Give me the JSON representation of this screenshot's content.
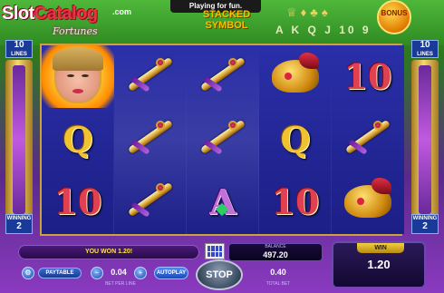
{
  "header": {
    "playing_banner": "Playing for fun.",
    "logo_slot": "Slot",
    "logo_catalog": "Catalog",
    "logo_com": ".com",
    "logo_sub": "Fortunes",
    "stacked_line1": "STACKED",
    "stacked_line2": "SYMBOL",
    "mini_letters": "A K Q J 10 9",
    "bonus_label": "BONUS"
  },
  "sides": {
    "left_lines_value": "10",
    "left_lines_label": "LINES",
    "right_lines_value": "10",
    "right_lines_label": "LINES",
    "left_winning_label": "WINNING",
    "left_winning_value": "2",
    "right_winning_label": "WINNING",
    "right_winning_value": "2"
  },
  "reels": [
    [
      "wild-woman",
      "Q",
      "10"
    ],
    [
      "dagger",
      "dagger",
      "dagger"
    ],
    [
      "dagger",
      "dagger",
      "A"
    ],
    [
      "lamp",
      "Q",
      "10"
    ],
    [
      "10",
      "dagger",
      "lamp"
    ]
  ],
  "symbol_text": {
    "q": "Q",
    "ten": "10",
    "a": "A"
  },
  "panel": {
    "message": "YOU WON 1.20!",
    "balance_label": "BALANCE",
    "balance_value": "497.20",
    "paytable_label": "PAYTABLE",
    "bet_per_line_value": "0.04",
    "bet_per_line_label": "BET PER LINE",
    "autoplay_label": "AUTOPLAY",
    "stop_label": "STOP",
    "total_bet_value": "0.40",
    "total_bet_label": "TOTAL BET",
    "win_label": "WIN",
    "win_value": "1.20"
  },
  "colors": {
    "reel_bg": "#1c1f86",
    "frame_gold": "#c9a23a",
    "top_green": "#3a9a2a",
    "bottom_purple": "#8a3ac0",
    "message_yellow": "#ffe24a"
  }
}
